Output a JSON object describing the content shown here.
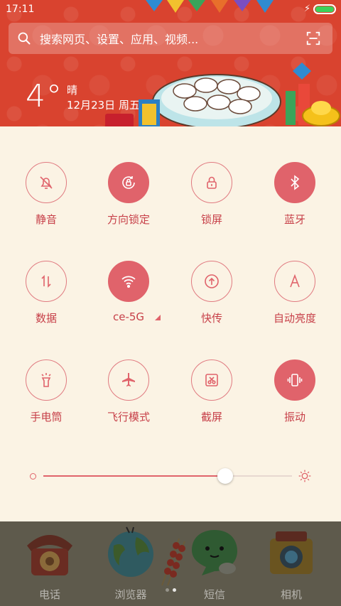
{
  "status_bar": {
    "time": "17:11",
    "charging_symbol": "⚡",
    "battery_level": 1.0
  },
  "search": {
    "placeholder": "搜索网页、设置、应用、视频..."
  },
  "weather": {
    "temperature": "4°",
    "condition": "晴",
    "date": "12月23日 周五"
  },
  "tiles": [
    {
      "id": "mute",
      "label": "静音",
      "icon": "bell-off-icon",
      "on": false
    },
    {
      "id": "rotation-lock",
      "label": "方向锁定",
      "icon": "rotation-lock-icon",
      "on": true
    },
    {
      "id": "lock-screen",
      "label": "锁屏",
      "icon": "lock-icon",
      "on": false
    },
    {
      "id": "bluetooth",
      "label": "蓝牙",
      "icon": "bluetooth-icon",
      "on": true
    },
    {
      "id": "data",
      "label": "数据",
      "icon": "data-arrows-icon",
      "on": false
    },
    {
      "id": "wifi",
      "label": "ce-5G",
      "icon": "wifi-icon",
      "on": true
    },
    {
      "id": "quick-share",
      "label": "快传",
      "icon": "upload-icon",
      "on": false
    },
    {
      "id": "auto-brightness",
      "label": "自动亮度",
      "icon": "letter-a-icon",
      "on": false
    },
    {
      "id": "flashlight",
      "label": "手电筒",
      "icon": "flashlight-icon",
      "on": false
    },
    {
      "id": "airplane",
      "label": "飞行模式",
      "icon": "airplane-icon",
      "on": false
    },
    {
      "id": "screenshot",
      "label": "截屏",
      "icon": "scissors-icon",
      "on": false
    },
    {
      "id": "vibrate",
      "label": "振动",
      "icon": "vibrate-icon",
      "on": true
    }
  ],
  "brightness": {
    "level": 0.73
  },
  "dock": [
    {
      "id": "phone",
      "label": "电话",
      "icon": "rotary-phone-icon"
    },
    {
      "id": "browser",
      "label": "浏览器",
      "icon": "globe-icon"
    },
    {
      "id": "messages",
      "label": "短信",
      "icon": "chat-bubble-icon"
    },
    {
      "id": "camera",
      "label": "相机",
      "icon": "camera-icon"
    }
  ],
  "page_indicator": {
    "count": 2,
    "active": 1
  },
  "colors": {
    "accent": "#e0636b",
    "header_red": "#d9432f",
    "panel_bg": "#fbf3e4",
    "battery_green": "#3cd25a"
  }
}
